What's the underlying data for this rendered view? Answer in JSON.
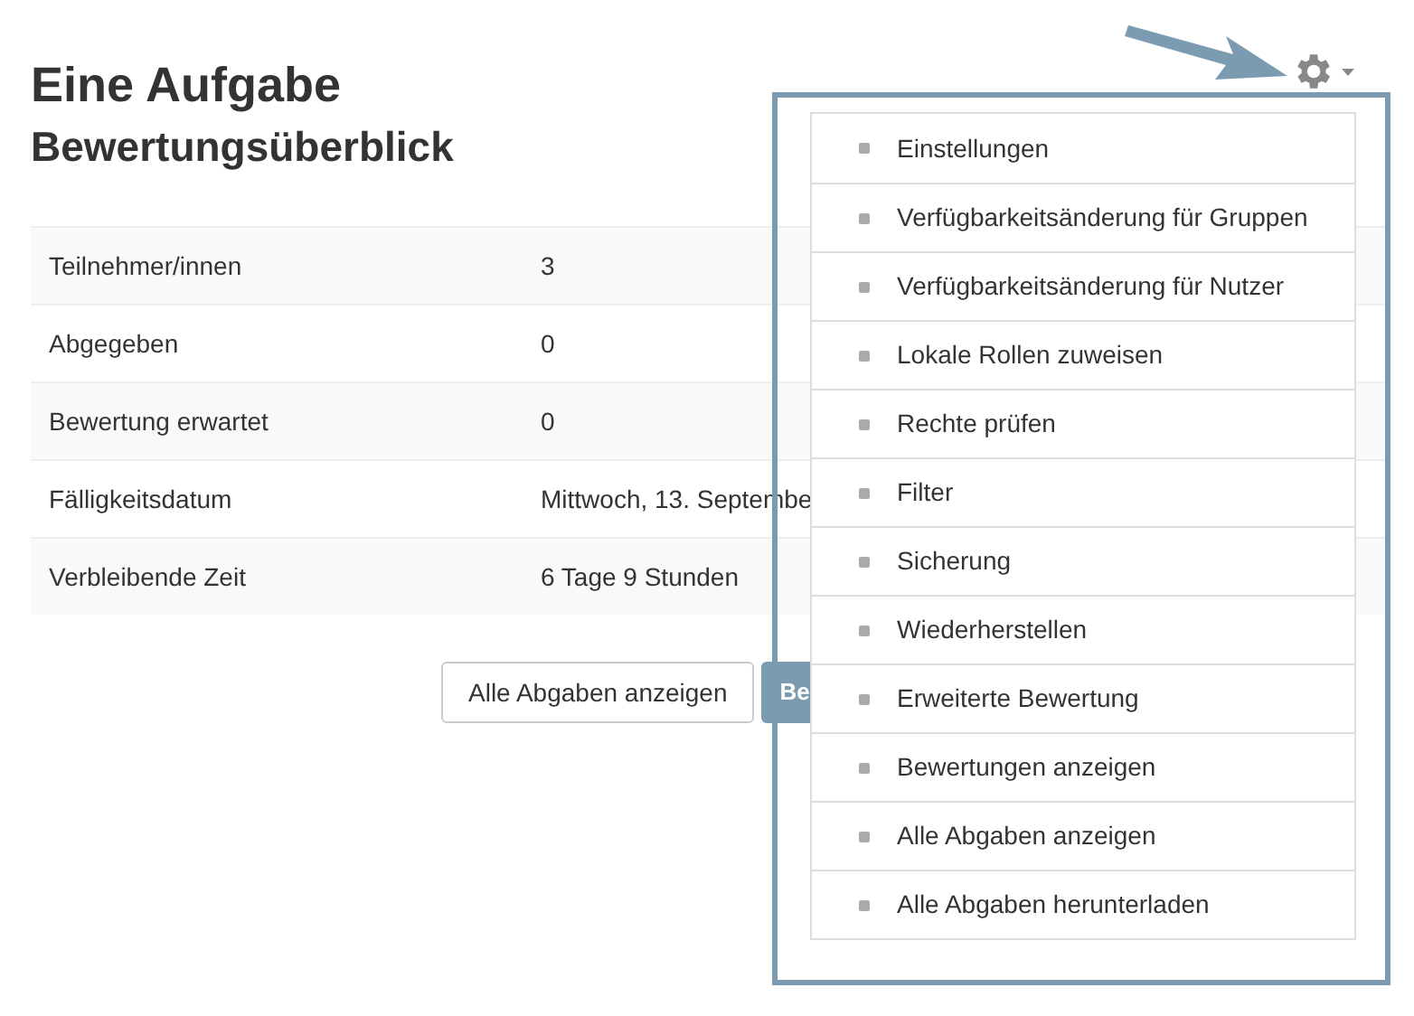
{
  "heading": {
    "title": "Eine Aufgabe",
    "subtitle": "Bewertungsüberblick"
  },
  "summary": [
    {
      "label": "Teilnehmer/innen",
      "value": "3"
    },
    {
      "label": "Abgegeben",
      "value": "0"
    },
    {
      "label": "Bewertung erwartet",
      "value": "0"
    },
    {
      "label": "Fälligkeitsdatum",
      "value": "Mittwoch, 13. Septembe"
    },
    {
      "label": "Verbleibende Zeit",
      "value": "6 Tage 9 Stunden"
    }
  ],
  "buttons": [
    {
      "label": "Alle Abgaben anzeigen",
      "kind": "secondary"
    },
    {
      "label": "Be",
      "kind": "primary"
    }
  ],
  "settings_menu": {
    "expanded": true,
    "items": [
      "Einstellungen",
      "Verfügbarkeitsänderung für Gruppen",
      "Verfügbarkeitsänderung für Nutzer",
      "Lokale Rollen zuweisen",
      "Rechte prüfen",
      "Filter",
      "Sicherung",
      "Wiederherstellen",
      "Erweiterte Bewertung",
      "Bewertungen anzeigen",
      "Alle Abgaben anzeigen",
      "Alle Abgaben herunterladen"
    ]
  }
}
